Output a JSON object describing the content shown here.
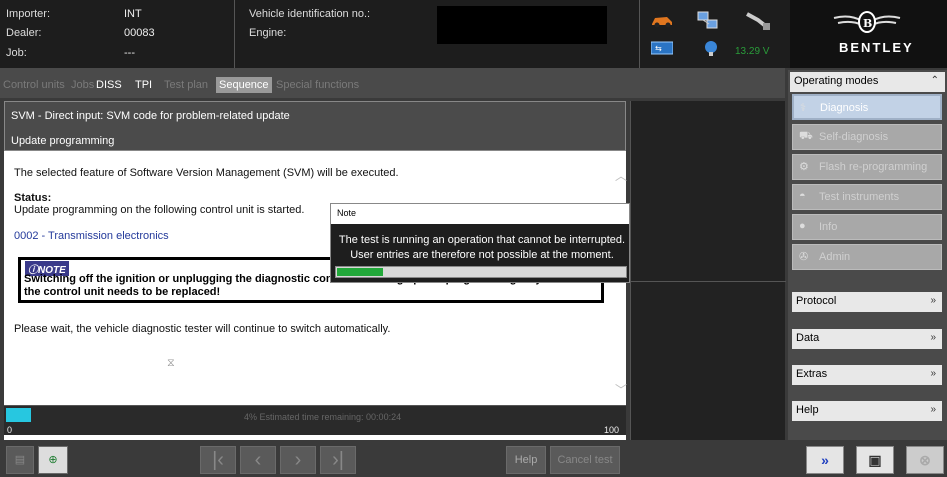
{
  "header": {
    "importer_label": "Importer:",
    "importer_value": "INT",
    "dealer_label": "Dealer:",
    "dealer_value": "00083",
    "job_label": "Job:",
    "job_value": "---",
    "vin_label": "Vehicle identification no.:",
    "engine_label": "Engine:",
    "voltage": "13.29 V",
    "brand": "BENTLEY"
  },
  "tabs": [
    {
      "label": "Control units"
    },
    {
      "label": "Jobs"
    },
    {
      "label": "DISS"
    },
    {
      "label": "TPI"
    },
    {
      "label": "Test plan"
    },
    {
      "label": "Sequence"
    },
    {
      "label": "Special functions"
    }
  ],
  "main": {
    "title_line1": "SVM - Direct input: SVM code for problem-related update",
    "title_line2": "Update programming",
    "intro": "The selected feature of Software Version Management (SVM) will be executed.",
    "status_label": "Status:",
    "status_text": "Update programming on the following control unit is started.",
    "control_unit": "0002 - Transmission electronics",
    "note_label": "NOTE",
    "note_line1": "Switching off the ignition or unplugging the diagnostic connector during update programming may mean",
    "note_line2": "the control unit needs to be replaced!",
    "wait_text": "Please wait, the vehicle diagnostic tester will continue to switch automatically."
  },
  "progress": {
    "percent": 4,
    "estimate": "4% Estimated time remaining: 00:00:24",
    "min_label": "0",
    "max_label": "100"
  },
  "toolbar": {
    "help_label": "Help",
    "cancel_label": "Cancel test"
  },
  "dialog": {
    "title": "Note",
    "line1": "The test is running an operation that cannot be interrupted.",
    "line2": "User entries are therefore not possible at the moment.",
    "progress_fraction": 0.16
  },
  "operating_modes": {
    "title": "Operating modes",
    "items": [
      {
        "label": "Diagnosis",
        "icon": "stethoscope-icon"
      },
      {
        "label": "Self-diagnosis",
        "icon": "car-icon"
      },
      {
        "label": "Flash re-programming",
        "icon": "chip-icon"
      },
      {
        "label": "Test instruments",
        "icon": "meter-icon"
      },
      {
        "label": "Info",
        "icon": "info-icon"
      },
      {
        "label": "Admin",
        "icon": "wrench-icon"
      }
    ]
  },
  "sections": {
    "protocol": "Protocol",
    "data": "Data",
    "extras": "Extras",
    "help": "Help"
  },
  "colors": {
    "accent": "#27c7e0",
    "progress_green": "#22a83a",
    "link": "#243a9b",
    "voltage": "#2a9c3a"
  }
}
